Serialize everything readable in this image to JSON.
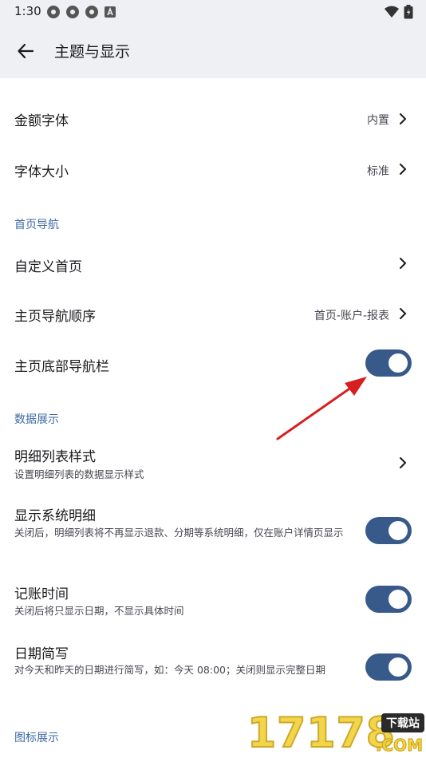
{
  "status_bar": {
    "time": "1:30"
  },
  "header": {
    "title": "主题与显示"
  },
  "settings": {
    "amount_font": {
      "title": "金额字体",
      "value": "内置"
    },
    "font_size": {
      "title": "字体大小",
      "value": "标准"
    },
    "section_home_nav": "首页导航",
    "custom_home": {
      "title": "自定义首页"
    },
    "nav_order": {
      "title": "主页导航顺序",
      "value": "首页-账户-报表"
    },
    "bottom_nav": {
      "title": "主页底部导航栏",
      "enabled": true
    },
    "section_data": "数据展示",
    "detail_style": {
      "title": "明细列表样式",
      "subtitle": "设置明细列表的数据显示样式"
    },
    "system_detail": {
      "title": "显示系统明细",
      "subtitle": "关闭后，明细列表将不再显示退款、分期等系统明细，仅在账户详情页显示",
      "enabled": true
    },
    "record_time": {
      "title": "记账时间",
      "subtitle": "关闭后将只显示日期，不显示具体时间",
      "enabled": true
    },
    "date_short": {
      "title": "日期简写",
      "subtitle": "对今天和昨天的日期进行简写，如：今天 08:00；关闭则显示完整日期",
      "enabled": true
    },
    "section_icon": "图标展示"
  },
  "watermark": {
    "number": "17178",
    "badge": "下载站",
    "domain": ".COM"
  },
  "colors": {
    "accent": "#375a8b",
    "section": "#3f6aa3",
    "header_bg": "#eff0f4",
    "annotation_arrow": "#d62020"
  }
}
